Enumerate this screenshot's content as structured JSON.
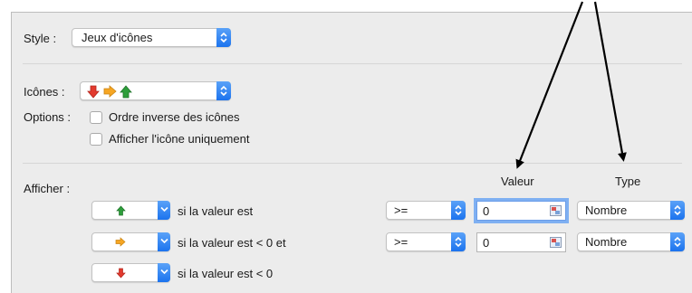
{
  "style": {
    "label": "Style :",
    "value": "Jeux d'icônes"
  },
  "icons": {
    "label": "Icônes :",
    "set": [
      "arrow-down-red-icon",
      "arrow-right-orange-icon",
      "arrow-up-green-icon"
    ]
  },
  "options": {
    "label": "Options :",
    "reverse": "Ordre inverse des icônes",
    "icon_only": "Afficher l'icône uniquement"
  },
  "display": {
    "label": "Afficher :",
    "value_header": "Valeur",
    "type_header": "Type",
    "rules": [
      {
        "icon": "arrow-up-green-icon",
        "text": "si la valeur est",
        "operator": ">=",
        "value": "0",
        "type": "Nombre"
      },
      {
        "icon": "arrow-right-orange-icon",
        "text": "si la valeur est < 0 et",
        "operator": ">=",
        "value": "0",
        "type": "Nombre"
      },
      {
        "icon": "arrow-down-red-icon",
        "text": "si la valeur est < 0"
      }
    ]
  },
  "colors": {
    "accent": "#1b73ee",
    "red": "#e23a2e",
    "orange": "#f6a623",
    "green": "#2e9e3b"
  }
}
